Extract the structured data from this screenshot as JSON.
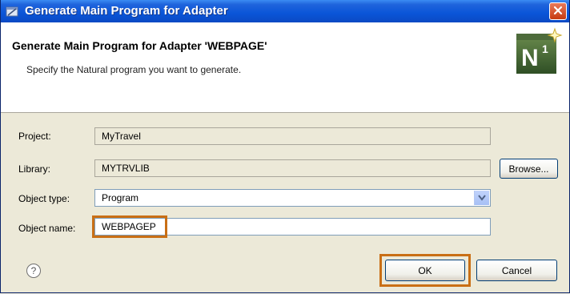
{
  "window": {
    "title": "Generate Main Program for Adapter"
  },
  "header": {
    "title": "Generate Main Program for Adapter 'WEBPAGE'",
    "description": "Specify the Natural program you want to generate.",
    "logo_text": "N",
    "logo_sup": "1"
  },
  "form": {
    "project_label": "Project:",
    "project_value": "MyTravel",
    "library_label": "Library:",
    "library_value": "MYTRVLIB",
    "browse_label": "Browse...",
    "object_type_label": "Object type:",
    "object_type_value": "Program",
    "object_name_label": "Object name:",
    "object_name_value": "WEBPAGEP"
  },
  "footer": {
    "help_glyph": "?",
    "ok_label": "OK",
    "cancel_label": "Cancel"
  },
  "colors": {
    "highlight": "#c96f15",
    "titlebar": "#0a55d8"
  }
}
